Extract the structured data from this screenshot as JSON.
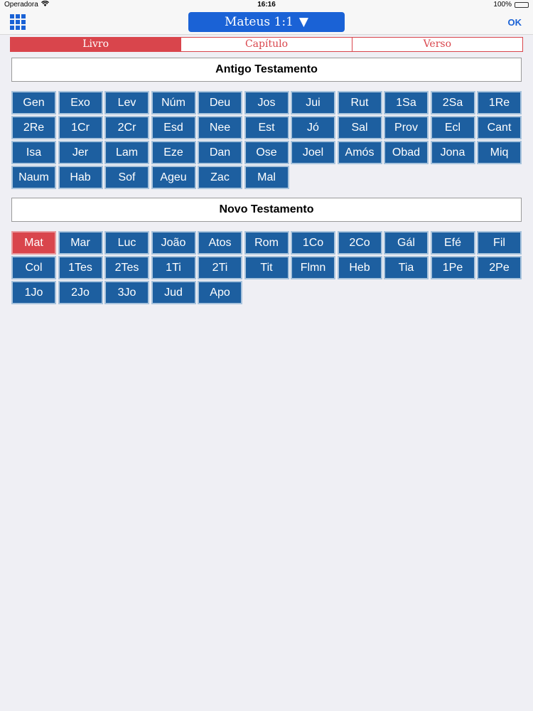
{
  "status": {
    "carrier": "Operadora",
    "time": "16:16",
    "battery": "100%",
    "battery_level": 1.0
  },
  "nav": {
    "title": "Mateus 1:1",
    "title_arrow": "▼",
    "ok": "OK"
  },
  "tabs": [
    {
      "label": "Livro",
      "active": true
    },
    {
      "label": "Capítulo",
      "active": false
    },
    {
      "label": "Verso",
      "active": false
    }
  ],
  "old_testament": {
    "title": "Antigo Testamento",
    "books": [
      "Gen",
      "Exo",
      "Lev",
      "Núm",
      "Deu",
      "Jos",
      "Jui",
      "Rut",
      "1Sa",
      "2Sa",
      "1Re",
      "2Re",
      "1Cr",
      "2Cr",
      "Esd",
      "Nee",
      "Est",
      "Jó",
      "Sal",
      "Prov",
      "Ecl",
      "Cant",
      "Isa",
      "Jer",
      "Lam",
      "Eze",
      "Dan",
      "Ose",
      "Joel",
      "Amós",
      "Obad",
      "Jona",
      "Miq",
      "Naum",
      "Hab",
      "Sof",
      "Ageu",
      "Zac",
      "Mal"
    ]
  },
  "new_testament": {
    "title": "Novo Testamento",
    "books": [
      "Mat",
      "Mar",
      "Luc",
      "João",
      "Atos",
      "Rom",
      "1Co",
      "2Co",
      "Gál",
      "Efé",
      "Fil",
      "Col",
      "1Tes",
      "2Tes",
      "1Ti",
      "2Ti",
      "Tit",
      "Flmn",
      "Heb",
      "Tia",
      "1Pe",
      "2Pe",
      "1Jo",
      "2Jo",
      "3Jo",
      "Jud",
      "Apo"
    ],
    "selected": "Mat"
  },
  "colors": {
    "accent_blue": "#1a62d6",
    "book_blue": "#1d5fa0",
    "accent_red": "#d9454c",
    "battery_green": "#4cd964"
  }
}
